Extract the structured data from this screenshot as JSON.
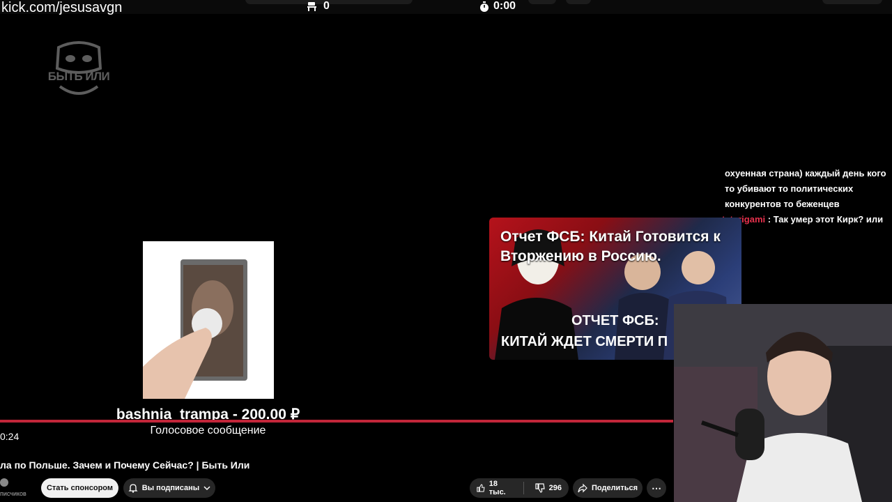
{
  "overlay": {
    "url": "kick.com/jesusavgn",
    "counter": "0",
    "timer": "0:00"
  },
  "channel_logo_text": "БЫТЬ ИЛИ",
  "chat": [
    {
      "user": "",
      "text": "охуенная страна) каждый день кого то убивают то политических конкурентов то беженцев"
    },
    {
      "user": "tatarigami",
      "text": " : Так умер этот Кирк? или не?"
    }
  ],
  "thumbnail": {
    "title": "Отчет ФСБ: Китай Готовится к Вторжению в Россию.",
    "line1": "ОТЧЕТ ФСБ:",
    "line2": "КИТАЙ ЖДЕТ СМЕРТИ П"
  },
  "donation": {
    "title": "bashnia_trampa - 200.00 ₽",
    "subtitle": "Голосовое сообщение"
  },
  "player": {
    "time": "0:24",
    "progress_fraction": 0.99
  },
  "video": {
    "title": "ла по Польше. Зачем и Почему Сейчас? | Быть Или",
    "subs": "писчиков",
    "sponsor_label": "Стать спонсором",
    "subscribed_label": "Вы подписаны",
    "likes": "18 тыс.",
    "dislikes": "296",
    "share_label": "Поделиться"
  },
  "colors": {
    "accent_red": "#c2263a",
    "chat_user": "#e8314d"
  },
  "icons": [
    "chair-icon",
    "stopwatch-icon",
    "bell-icon",
    "chevron-down-icon",
    "thumbs-up-icon",
    "thumbs-down-icon",
    "share-icon",
    "more-icon"
  ]
}
